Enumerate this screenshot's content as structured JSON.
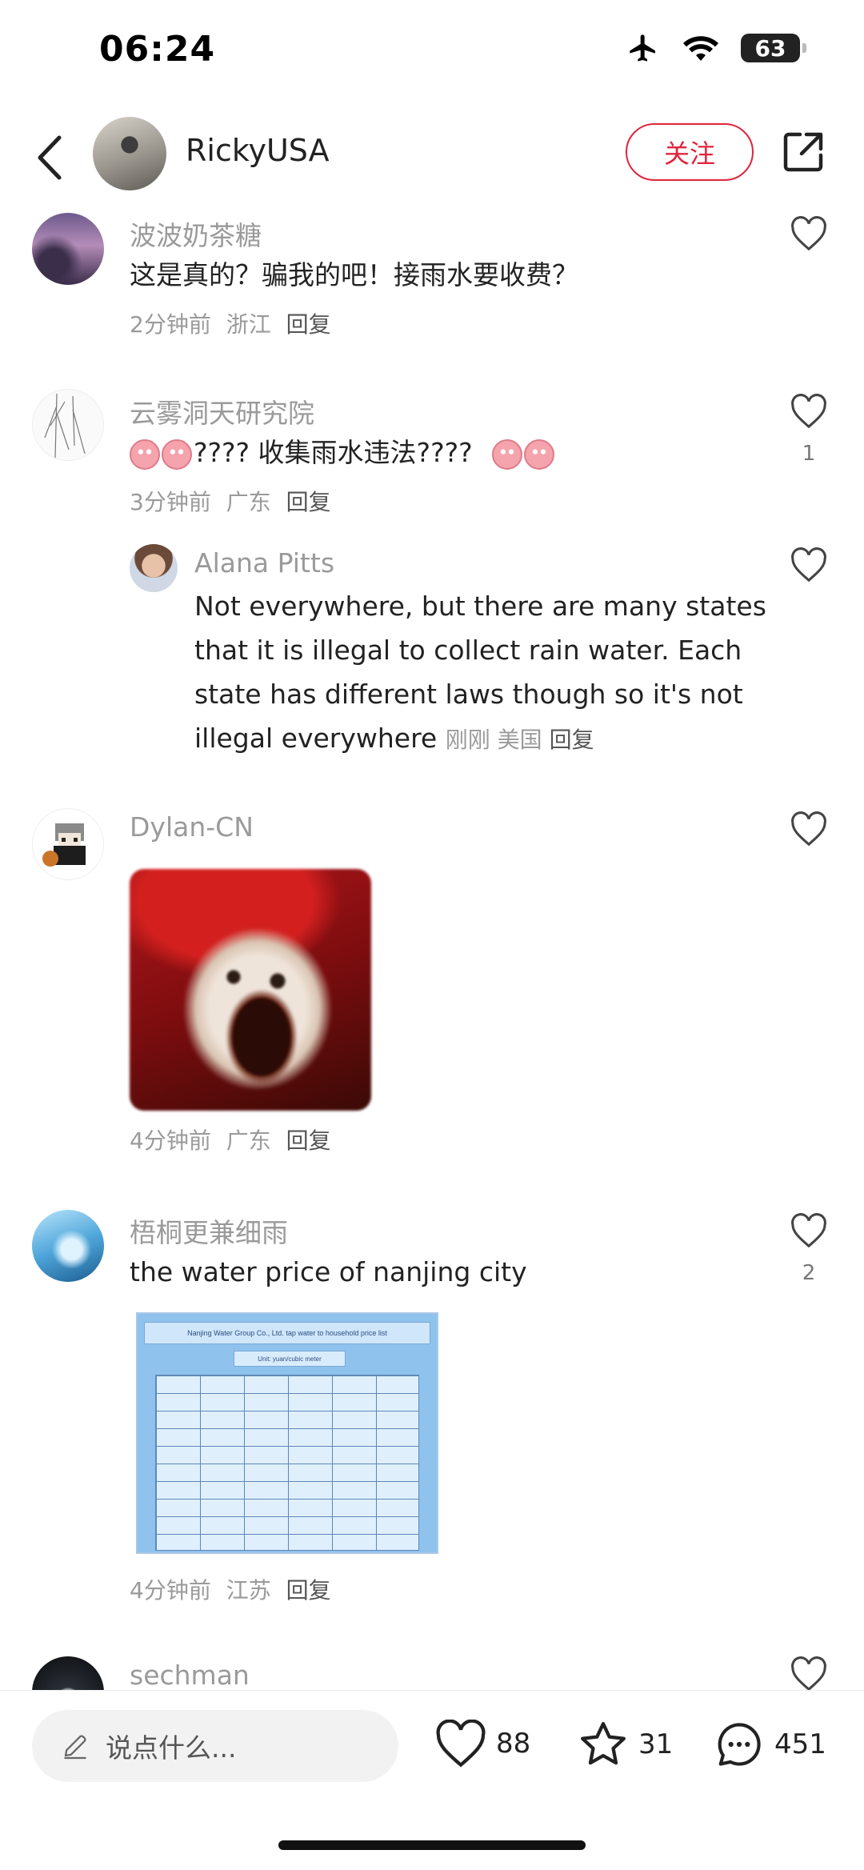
{
  "status_bar": {
    "time": "06:24",
    "battery": "63"
  },
  "header": {
    "username": "RickyUSA",
    "follow_label": "关注"
  },
  "comments": [
    {
      "username": "波波奶茶糖",
      "text": "这是真的？骗我的吧！接雨水要收费？",
      "time": "2分钟前",
      "location": "浙江",
      "reply": "回复",
      "likes": ""
    },
    {
      "username": "云雾洞天研究院",
      "text": "????  收集雨水违法????",
      "time": "3分钟前",
      "location": "广东",
      "reply": "回复",
      "likes": "1",
      "replies": [
        {
          "username": "Alana Pitts",
          "text_lines": [
            "Not everywhere, but there are many states",
            "that it is illegal to collect rain water. Each",
            "state has different laws though so it's not",
            "illegal everywhere"
          ],
          "time": "刚刚",
          "location": "美国",
          "reply": "回复"
        }
      ]
    },
    {
      "username": "Dylan-CN",
      "text": "",
      "time": "4分钟前",
      "location": "广东",
      "reply": "回复",
      "likes": ""
    },
    {
      "username": "梧桐更兼细雨",
      "text": "the water price of nanjing city",
      "time": "4分钟前",
      "location": "江苏",
      "reply": "回复",
      "likes": "2",
      "image": {
        "title": "Nanjing Water Group Co., Ltd. tap water to household price list",
        "unit": "Unit: yuan/cubic meter"
      }
    },
    {
      "username": "sechman"
    }
  ],
  "bottom_bar": {
    "placeholder": "说点什么...",
    "likes": "88",
    "stars": "31",
    "comments": "451"
  },
  "colors": {
    "accent": "#e0243d",
    "secondary_text": "#9a9a9a"
  }
}
